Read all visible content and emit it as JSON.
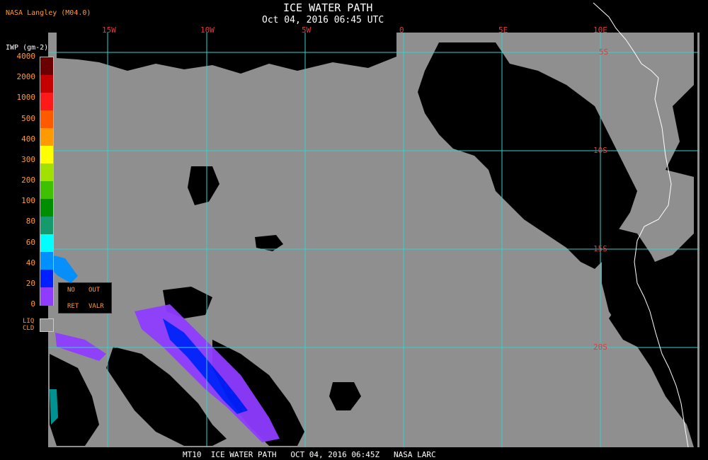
{
  "header": {
    "title": "ICE WATER PATH",
    "subtitle": "Oct 04, 2016 06:45 UTC",
    "producer": "NASA Langley (M04.0)"
  },
  "footer": {
    "text": "MT10  ICE WATER PATH   OCT 04, 2016 06:45Z   NASA LARC"
  },
  "map": {
    "longitude_labels": [
      "15W",
      "10W",
      "5W",
      "0",
      "5E",
      "10E"
    ],
    "latitude_labels": [
      "5S",
      "10S",
      "15S",
      "20S"
    ],
    "colors": {
      "background": "#000000",
      "cloud_gray": "#8f8f8f",
      "grid": "#2fd3d3",
      "coastline": "#ffffff",
      "label_red": "#e23a3a",
      "label_orange": "#ff9a33"
    }
  },
  "legend": {
    "unit_label": "IWP (gm-2)",
    "ticks": [
      "4000",
      "2000",
      "1000",
      "500",
      "400",
      "300",
      "200",
      "100",
      "80",
      "60",
      "40",
      "20",
      "0"
    ],
    "colors": [
      "#6b0000",
      "#c40000",
      "#ff1a1a",
      "#ff5a00",
      "#ff9a00",
      "#ffff00",
      "#a2e000",
      "#3fc000",
      "#008e00",
      "#159a6e",
      "#00ffff",
      "#0090ff",
      "#0020ff",
      "#8f3cff"
    ],
    "no_retrieval": {
      "line1a": "NO",
      "line1b": "OUT",
      "line2a": "RET",
      "line2b": "VALR"
    },
    "liquid_cloud": {
      "line1": "LIQ",
      "line2": "CLD"
    }
  }
}
